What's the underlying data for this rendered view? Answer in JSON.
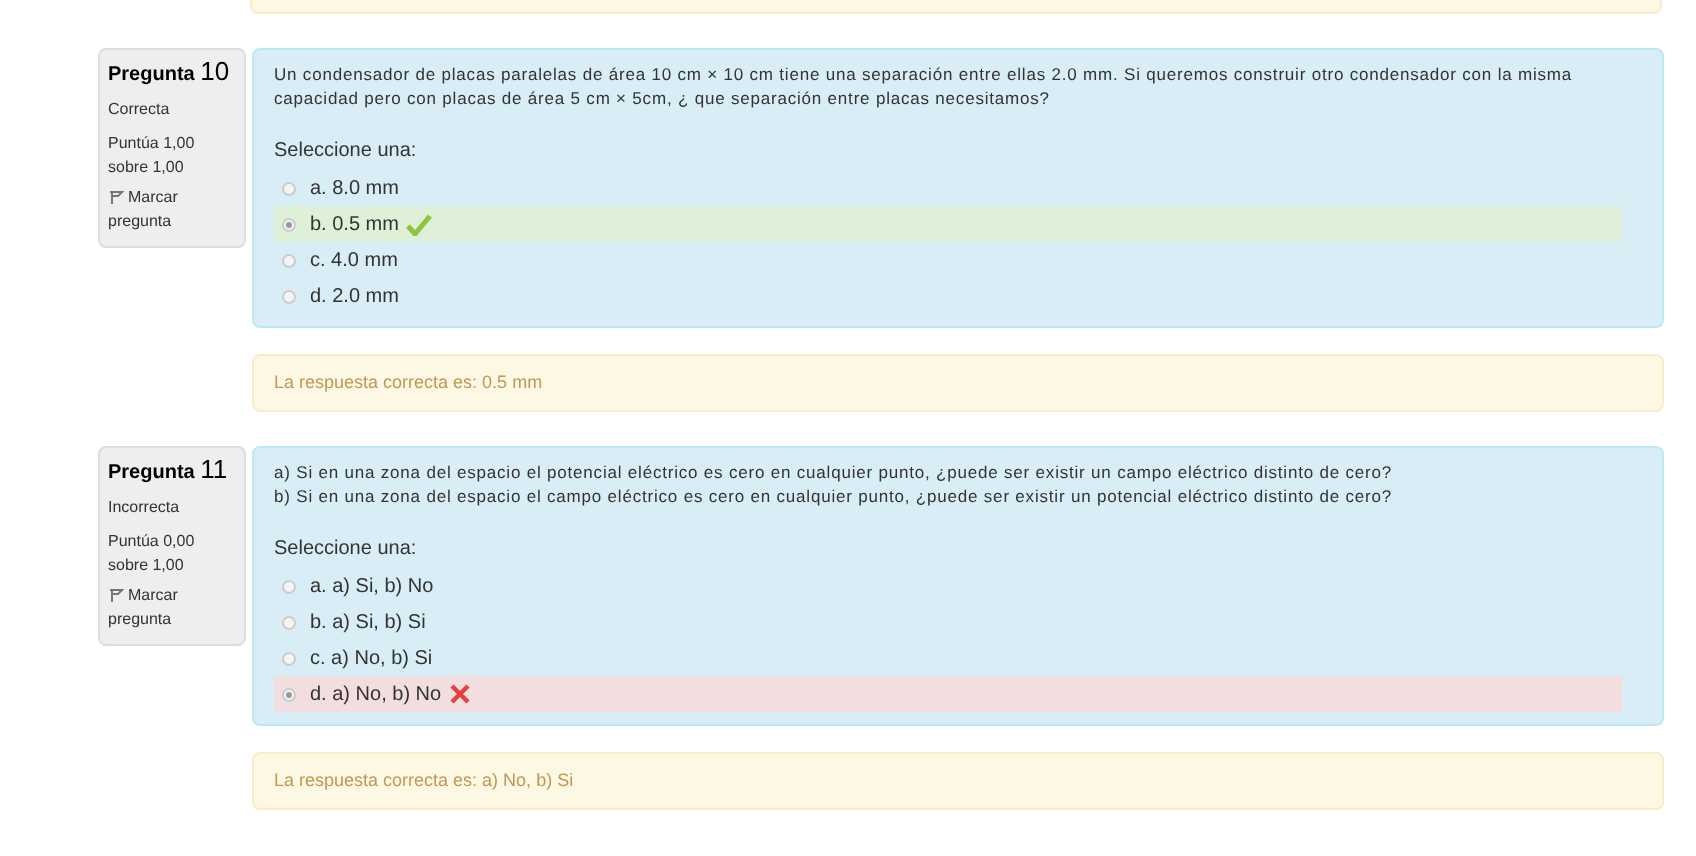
{
  "questions": [
    {
      "label": "Pregunta",
      "number": "10",
      "status": "Correcta",
      "score": "Puntúa 1,00 sobre 1,00",
      "flag": "Marcar pregunta",
      "text": [
        "Un condensador de placas paralelas de área 10 cm × 10 cm tiene una separación entre ellas 2.0 mm. Si queremos construir otro condensador con la misma capacidad pero con placas de área 5 cm × 5cm, ¿ que separación entre placas necesitamos?"
      ],
      "prompt": "Seleccione una:",
      "options": [
        {
          "label": "a. 8.0 mm",
          "selected": false,
          "kind": "plain"
        },
        {
          "label": "b. 0.5 mm",
          "selected": true,
          "kind": "correct"
        },
        {
          "label": "c. 4.0 mm",
          "selected": false,
          "kind": "plain"
        },
        {
          "label": "d. 2.0 mm",
          "selected": false,
          "kind": "plain"
        }
      ],
      "feedback": "La respuesta correcta es: 0.5 mm"
    },
    {
      "label": "Pregunta",
      "number": "11",
      "status": "Incorrecta",
      "score": "Puntúa 0,00 sobre 1,00",
      "flag": "Marcar pregunta",
      "text": [
        "a) Si en una zona del espacio el potencial eléctrico es cero en cualquier punto, ¿puede ser existir un campo eléctrico distinto de cero?",
        "b) Si en una zona del espacio el campo eléctrico es cero en cualquier punto, ¿puede ser existir un  potencial eléctrico distinto de cero?"
      ],
      "prompt": "Seleccione una:",
      "options": [
        {
          "label": "a. a) Si, b) No",
          "selected": false,
          "kind": "plain"
        },
        {
          "label": "b. a) Si, b) Si",
          "selected": false,
          "kind": "plain"
        },
        {
          "label": "c. a) No, b) Si",
          "selected": false,
          "kind": "plain"
        },
        {
          "label": "d. a) No, b) No",
          "selected": true,
          "kind": "incorrect"
        }
      ],
      "feedback": "La respuesta correcta es: a) No, b) Si"
    }
  ]
}
